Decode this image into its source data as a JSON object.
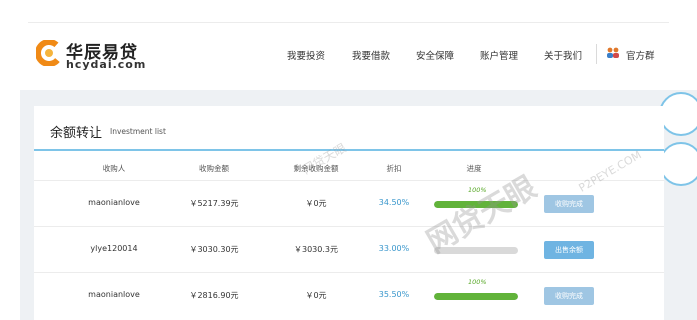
{
  "brand": {
    "name": "华辰易贷",
    "domain": "hcydai.com",
    "colors": {
      "orange": "#f08a16",
      "blue": "#3a97cc",
      "green": "#61b33a"
    }
  },
  "nav": {
    "items": [
      "我要投资",
      "我要借款",
      "安全保障",
      "账户管理",
      "关于我们"
    ],
    "group_label": "官方群",
    "group_icon": "people-icon"
  },
  "panel": {
    "title": "余额转让",
    "subtitle": "Investment list"
  },
  "table": {
    "headers": [
      "收购人",
      "收购金额",
      "剩余收购金额",
      "折扣",
      "进度"
    ],
    "rows": [
      {
        "buyer": "maonianlove",
        "amount": "￥5217.39元",
        "remaining": "￥0元",
        "discount": "34.50%",
        "progress_label": "100%",
        "progress": 1.0,
        "action": "收购完成",
        "action_state": "done"
      },
      {
        "buyer": "ylye120014",
        "amount": "￥3030.30元",
        "remaining": "￥3030.3元",
        "discount": "33.00%",
        "progress_label": "",
        "progress": 0.0,
        "action": "出售余额",
        "action_state": "sell"
      },
      {
        "buyer": "maonianlove",
        "amount": "￥2816.90元",
        "remaining": "￥0元",
        "discount": "35.50%",
        "progress_label": "100%",
        "progress": 1.0,
        "action": "收购完成",
        "action_state": "done"
      }
    ]
  },
  "watermark": {
    "main": "网贷天眼",
    "url": "P2PEYE.COM"
  }
}
